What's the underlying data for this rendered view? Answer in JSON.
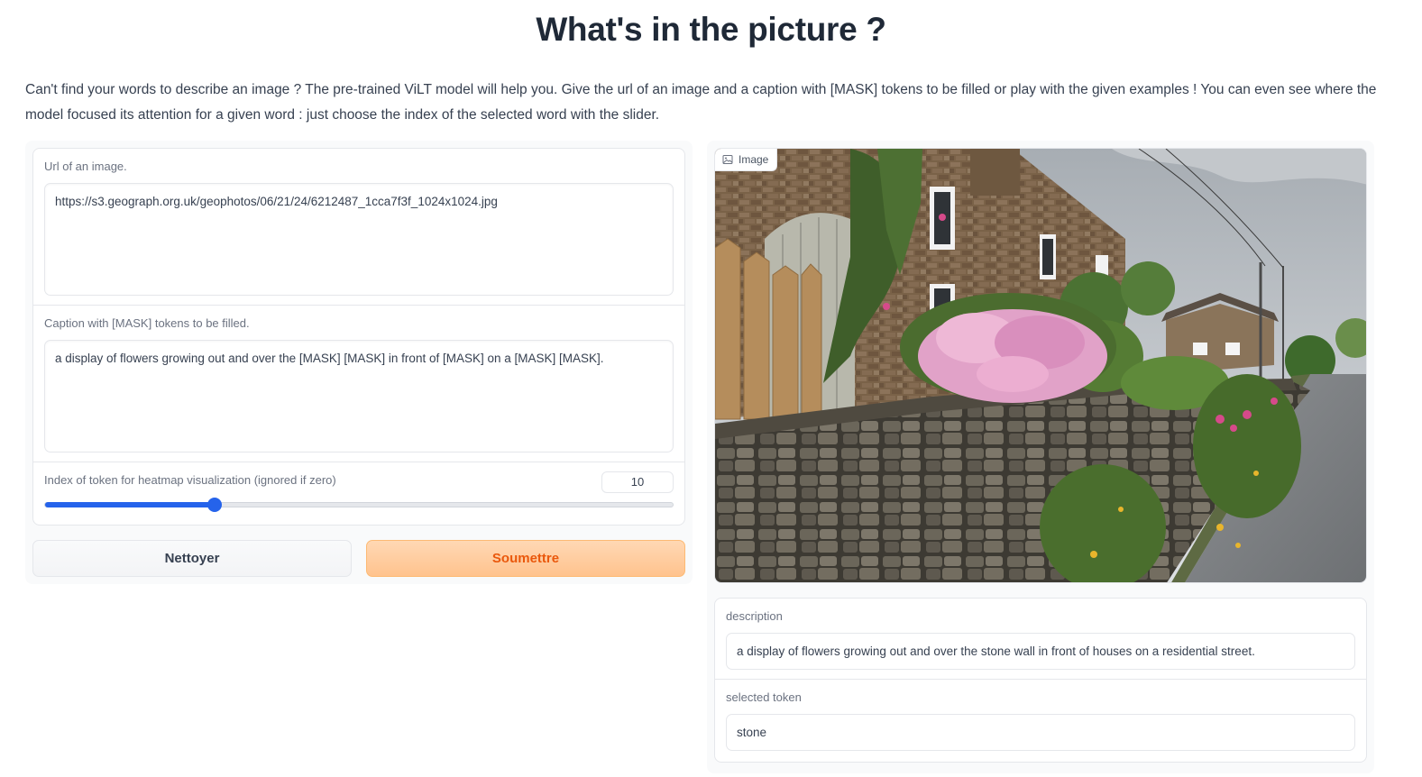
{
  "title": "What's in the picture ?",
  "intro": "Can't find your words to describe an image ? The pre-trained ViLT model will help you. Give the url of an image and a caption with [MASK] tokens to be filled or play with the given examples ! You can even see where the model focused its attention for a given word : just choose the index of the selected word with the slider.",
  "form": {
    "url": {
      "label": "Url of an image.",
      "value": "https://s3.geograph.org.uk/geophotos/06/21/24/6212487_1cca7f3f_1024x1024.jpg"
    },
    "caption": {
      "label": "Caption with [MASK] tokens to be filled.",
      "value": "a display of flowers growing out and over the [MASK] [MASK] in front of [MASK] on a [MASK] [MASK]."
    },
    "token_index": {
      "label": "Index of token for heatmap visualization (ignored if zero)",
      "value": "10",
      "slider_fraction": 0.27
    }
  },
  "buttons": {
    "clear": "Nettoyer",
    "submit": "Soumettre"
  },
  "image_panel": {
    "label": "Image",
    "icon": "image-icon"
  },
  "output": {
    "description": {
      "label": "description",
      "value": "a display of flowers growing out and over the stone wall in front of houses on a residential street."
    },
    "selected_token": {
      "label": "selected token",
      "value": "stone"
    }
  },
  "colors": {
    "accent": "#2563eb",
    "submit_text": "#ea580c",
    "submit_bg": "#ffc38e"
  }
}
